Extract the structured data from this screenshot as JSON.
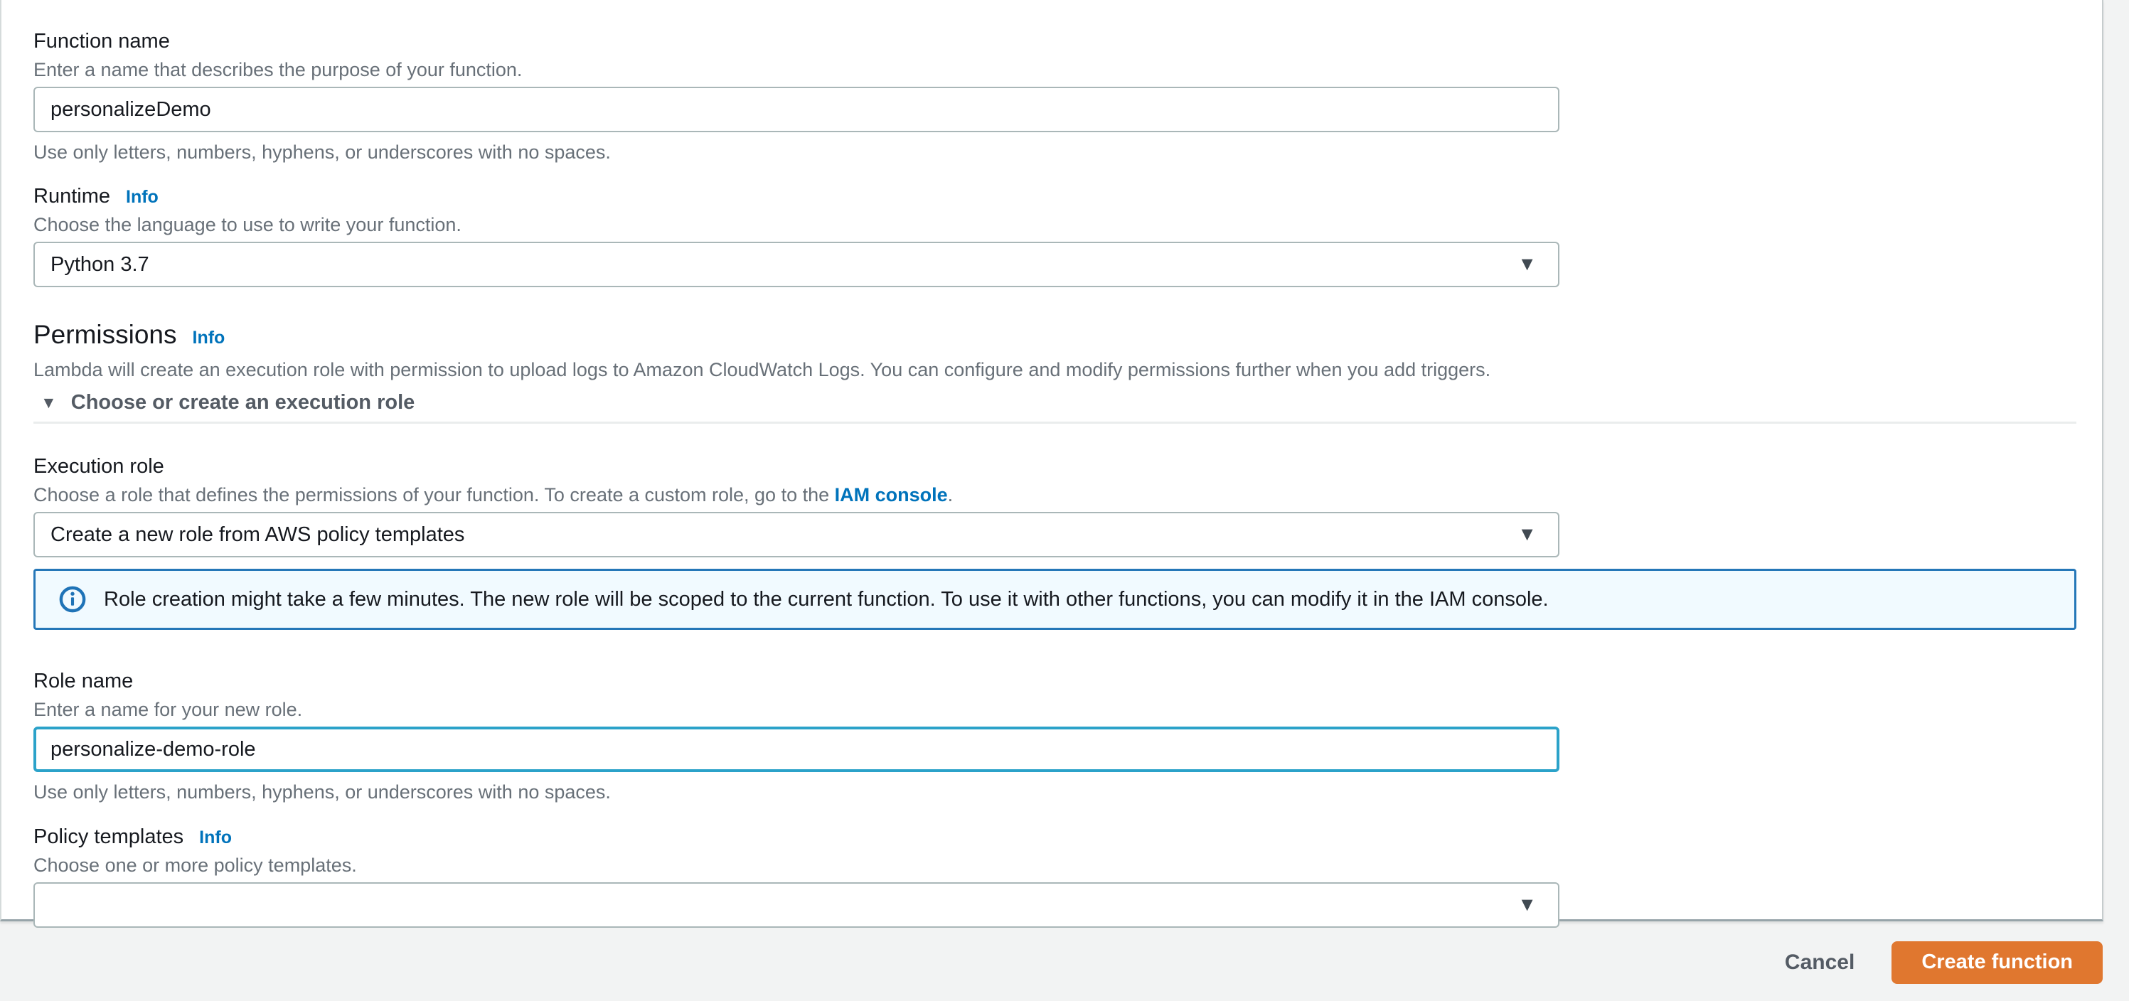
{
  "colors": {
    "page_background": "#f2f3f3",
    "card_background": "#ffffff",
    "link_blue": "#0073bb",
    "focus_border_blue": "#2ba2c9",
    "alert_border_blue": "#2577b8",
    "alert_background": "#f1faff",
    "primary_button_orange": "#e0772f",
    "label_text": "#16191f",
    "secondary_text": "#687078",
    "expander_text": "#545b64",
    "input_border": "#aab7b8"
  },
  "form": {
    "function_name": {
      "label": "Function name",
      "description": "Enter a name that describes the purpose of your function.",
      "value": "personalizeDemo",
      "helper": "Use only letters, numbers, hyphens, or underscores with no spaces."
    },
    "runtime": {
      "label": "Runtime",
      "info_label": "Info",
      "description": "Choose the language to use to write your function.",
      "value": "Python 3.7",
      "arrow_icon": "▼"
    },
    "permissions": {
      "heading": "Permissions",
      "info_label": "Info",
      "description": "Lambda will create an execution role with permission to upload logs to Amazon CloudWatch Logs. You can configure and modify permissions further when you add triggers.",
      "expander_icon": "▼",
      "expander_label": "Choose or create an execution role"
    },
    "execution_role": {
      "label": "Execution role",
      "description_prefix": "Choose a role that defines the permissions of your function. To create a custom role, go to the ",
      "link_label": "IAM console",
      "description_suffix": ".",
      "value": "Create a new role from AWS policy templates",
      "arrow_icon": "▼"
    },
    "role_alert": {
      "text": "Role creation might take a few minutes. The new role will be scoped to the current function. To use it with other functions, you can modify it in the IAM console."
    },
    "role_name": {
      "label": "Role name",
      "description": "Enter a name for your new role.",
      "value": "personalize-demo-role",
      "helper": "Use only letters, numbers, hyphens, or underscores with no spaces."
    },
    "policy_templates": {
      "label": "Policy templates",
      "info_label": "Info",
      "description": "Choose one or more policy templates.",
      "value": "",
      "arrow_icon": "▼"
    }
  },
  "footer": {
    "cancel_label": "Cancel",
    "create_label": "Create function"
  }
}
